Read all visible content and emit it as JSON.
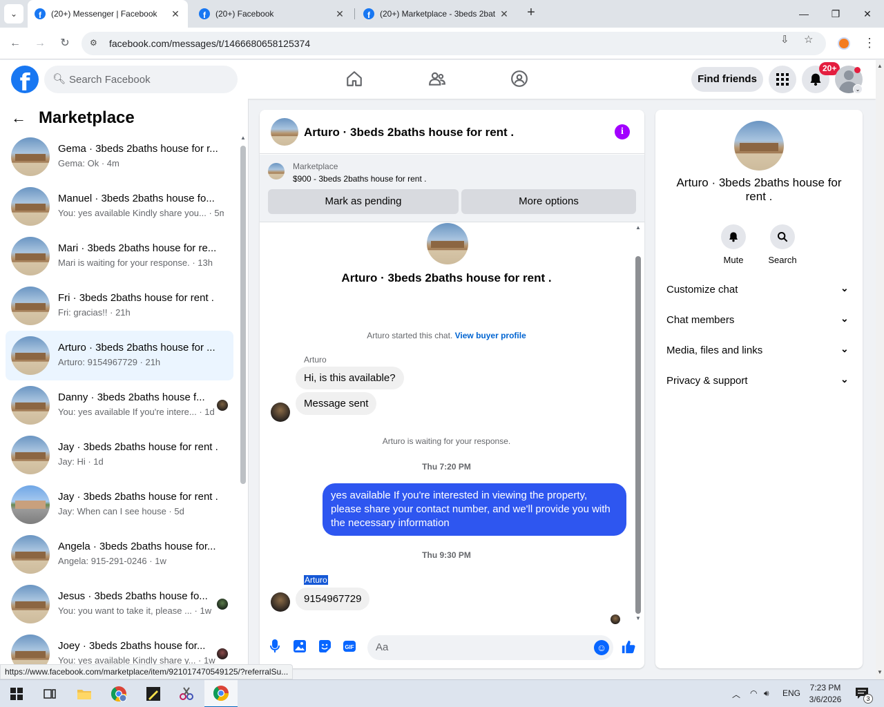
{
  "browser": {
    "tabs": [
      {
        "title": "(20+) Messenger | Facebook",
        "active": true
      },
      {
        "title": "(20+) Facebook",
        "active": false
      },
      {
        "title": "(20+) Marketplace - 3beds 2bat",
        "active": false
      }
    ],
    "url": "facebook.com/messages/t/1466680658125374",
    "status_url": "https://www.facebook.com/marketplace/item/921017470549125/?referralSu..."
  },
  "fb_header": {
    "logo": "f",
    "search_placeholder": "Search Facebook",
    "find_friends": "Find friends",
    "notif_badge": "20+"
  },
  "sidebar": {
    "title": "Marketplace",
    "conversations": [
      {
        "name": "Gema · 3beds 2baths house for r...",
        "preview": "Gema: Ok · 4m",
        "selected": false
      },
      {
        "name": "Manuel · 3beds 2baths house fo...",
        "preview": "You: yes available Kindly share you... · 5m",
        "selected": false
      },
      {
        "name": "Mari · 3beds 2baths house for re...",
        "preview": "Mari is waiting for your response. · 13h",
        "selected": false
      },
      {
        "name": "Fri · 3beds 2baths house for rent .",
        "preview": "Fri: gracias!! · 21h",
        "selected": false
      },
      {
        "name": "Arturo · 3beds 2baths house for ...",
        "preview": "Arturo: 9154967729 · 21h",
        "selected": true
      },
      {
        "name": "Danny · 3beds 2baths house f...",
        "preview": "You: yes available If you're intere... · 1d",
        "selected": false
      },
      {
        "name": "Jay · 3beds 2baths house for rent .",
        "preview": "Jay: Hi · 1d",
        "selected": false
      },
      {
        "name": "Jay · 3beds 2baths house for rent .",
        "preview": "Jay: When can I see house · 5d",
        "selected": false
      },
      {
        "name": "Angela · 3beds 2baths house for...",
        "preview": "Angela: 915-291-0246 · 1w",
        "selected": false
      },
      {
        "name": "Jesus · 3beds 2baths house fo...",
        "preview": "You: you want to take it, please ... · 1w",
        "selected": false
      },
      {
        "name": "Joey · 3beds 2baths house for...",
        "preview": "You: yes available Kindly share y... · 1w",
        "selected": false
      }
    ]
  },
  "chat": {
    "title": "Arturo · 3beds 2baths house for rent .",
    "marketplace_label": "Marketplace",
    "listing": "$900 - 3beds 2baths house for rent .",
    "mark_pending": "Mark as pending",
    "more_options": "More options",
    "center_name": "Arturo · 3beds 2baths house for rent .",
    "started_text": "Arturo started this chat.",
    "view_profile": "View buyer profile",
    "sender1": "Arturo",
    "msg1": "Hi, is this available?",
    "msg2": "Message sent",
    "waiting": "Arturo is waiting for your response.",
    "time1": "Thu 7:20 PM",
    "out_msg": "yes available  If you're interested in viewing the property, please share your contact number, and we'll provide you with the necessary information",
    "time2": "Thu 9:30 PM",
    "sender2": "Arturo",
    "msg3": "9154967729",
    "composer_placeholder": "Aa"
  },
  "info_panel": {
    "name": "Arturo · 3beds 2baths house for rent .",
    "mute": "Mute",
    "search": "Search",
    "sections": [
      "Customize chat",
      "Chat members",
      "Media, files and links",
      "Privacy & support"
    ]
  },
  "taskbar": {
    "lang": "ENG",
    "time": "7:23 PM",
    "date": "3/6/2026",
    "notif_count": "3"
  },
  "colors": {
    "fb_blue": "#1877f2",
    "outgoing_bubble": "#2e56f0",
    "selected_conv": "#ebf5ff",
    "info_icon": "#a200ff",
    "badge_red": "#e41e3f"
  }
}
